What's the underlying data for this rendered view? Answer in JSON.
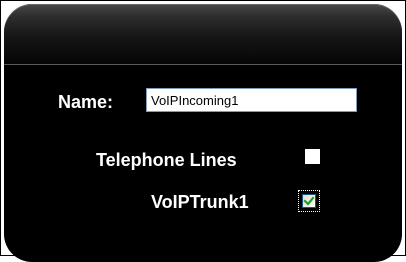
{
  "form": {
    "name_label": "Name:",
    "name_value": "VoIPIncoming1",
    "telephone_lines_label": "Telephone Lines",
    "telephone_lines_checked": false,
    "voip_trunk_label": "VoIPTrunk1",
    "voip_trunk_checked": true
  },
  "colors": {
    "panel_background": "#000000",
    "label_text": "#ffffff",
    "checkmark": "#21a121"
  },
  "icons": {
    "checkmark": "checkmark-icon"
  }
}
